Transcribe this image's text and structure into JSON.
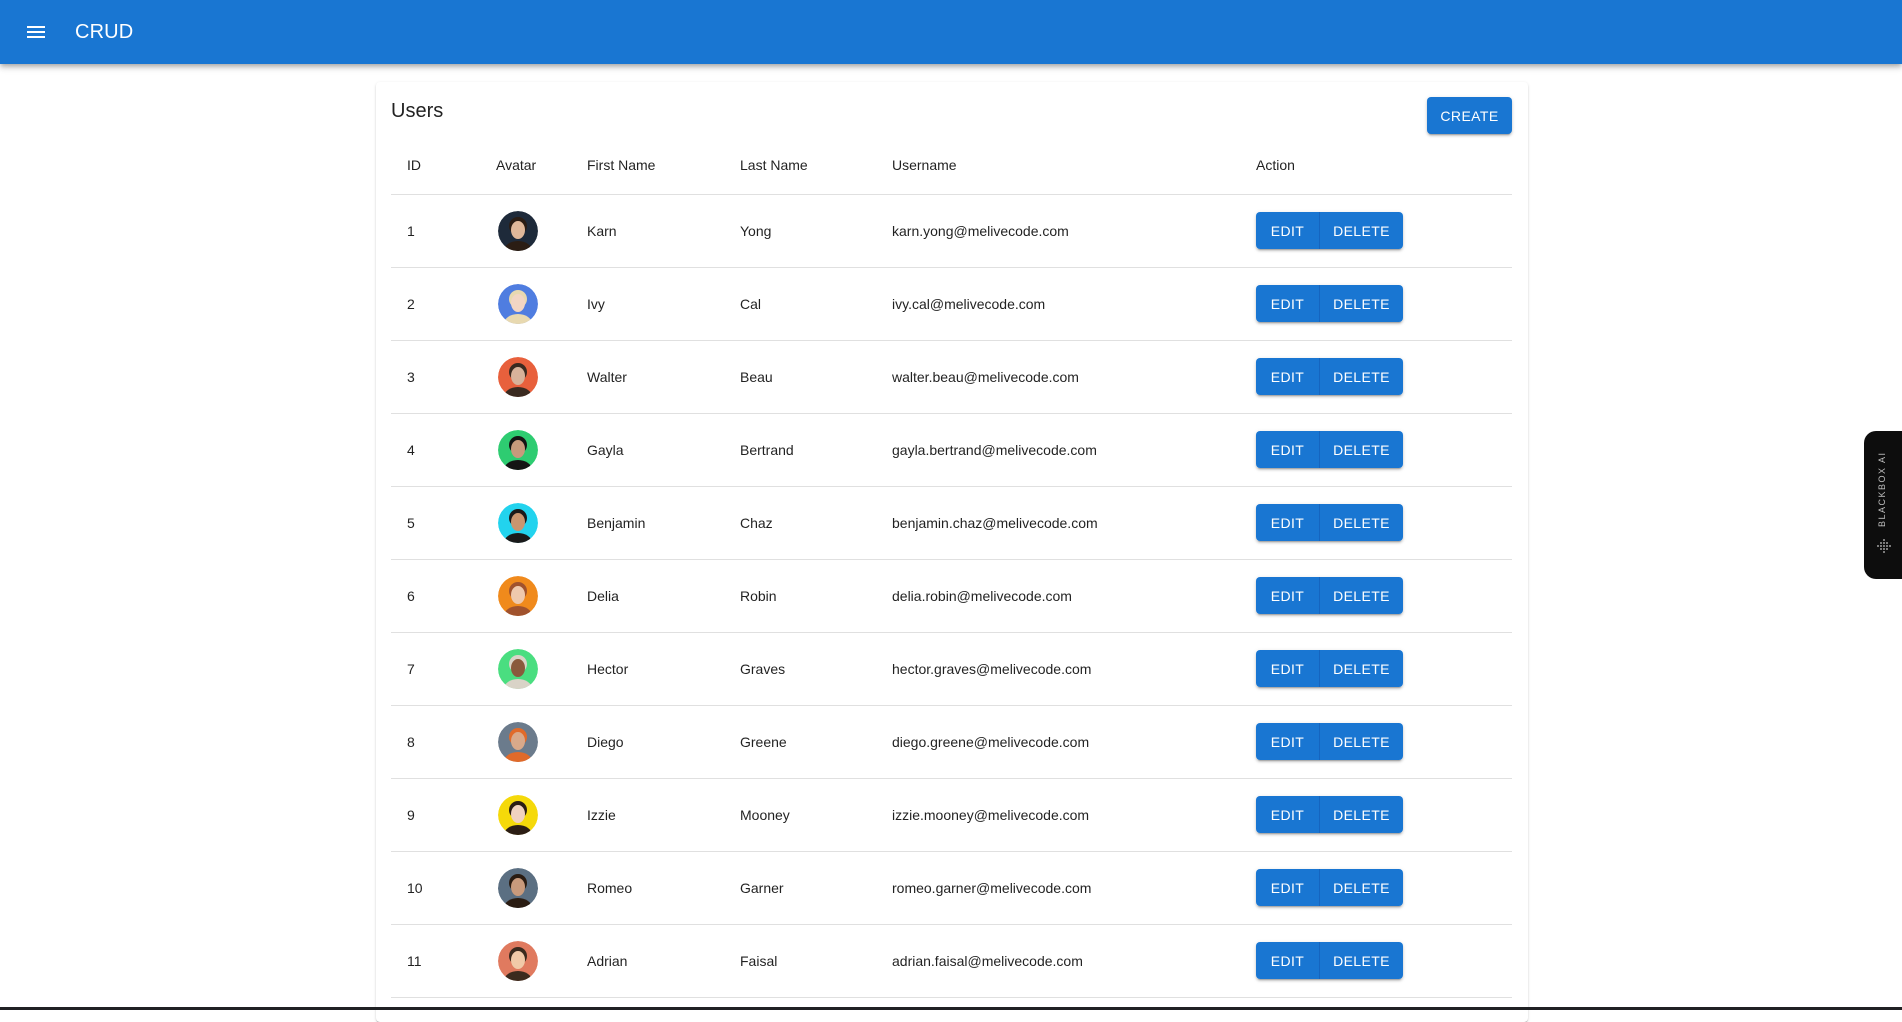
{
  "appbar": {
    "title": "CRUD",
    "menu_icon": "menu-icon",
    "color": "#1976d2"
  },
  "page": {
    "title": "Users",
    "create_label": "CREATE"
  },
  "table": {
    "columns": {
      "id": "ID",
      "avatar": "Avatar",
      "first_name": "First Name",
      "last_name": "Last Name",
      "username": "Username",
      "action": "Action"
    },
    "edit_label": "EDIT",
    "delete_label": "DELETE",
    "rows": [
      {
        "id": "1",
        "first_name": "Karn",
        "last_name": "Yong",
        "username": "karn.yong@melivecode.com",
        "avatar_bg": "#1e2a3a",
        "avatar_skin": "#e0b89a",
        "avatar_hair": "#2b1d14"
      },
      {
        "id": "2",
        "first_name": "Ivy",
        "last_name": "Cal",
        "username": "ivy.cal@melivecode.com",
        "avatar_bg": "#4f7de0",
        "avatar_skin": "#f2d6c4",
        "avatar_hair": "#e8d9b0"
      },
      {
        "id": "3",
        "first_name": "Walter",
        "last_name": "Beau",
        "username": "walter.beau@melivecode.com",
        "avatar_bg": "#e8603c",
        "avatar_skin": "#d8b29a",
        "avatar_hair": "#3a2a20"
      },
      {
        "id": "4",
        "first_name": "Gayla",
        "last_name": "Bertrand",
        "username": "gayla.bertrand@melivecode.com",
        "avatar_bg": "#2ecc71",
        "avatar_skin": "#c89a7c",
        "avatar_hair": "#141414"
      },
      {
        "id": "5",
        "first_name": "Benjamin",
        "last_name": "Chaz",
        "username": "benjamin.chaz@melivecode.com",
        "avatar_bg": "#22d3ee",
        "avatar_skin": "#c9956f",
        "avatar_hair": "#1a1a1a"
      },
      {
        "id": "6",
        "first_name": "Delia",
        "last_name": "Robin",
        "username": "delia.robin@melivecode.com",
        "avatar_bg": "#f08a1c",
        "avatar_skin": "#efc9ad",
        "avatar_hair": "#a0522d"
      },
      {
        "id": "7",
        "first_name": "Hector",
        "last_name": "Graves",
        "username": "hector.graves@melivecode.com",
        "avatar_bg": "#4ade80",
        "avatar_skin": "#8a5a3c",
        "avatar_hair": "#d9d3c7"
      },
      {
        "id": "8",
        "first_name": "Diego",
        "last_name": "Greene",
        "username": "diego.greene@melivecode.com",
        "avatar_bg": "#6b7b8c",
        "avatar_skin": "#d9a98a",
        "avatar_hair": "#e06a2a"
      },
      {
        "id": "9",
        "first_name": "Izzie",
        "last_name": "Mooney",
        "username": "izzie.mooney@melivecode.com",
        "avatar_bg": "#f5d90a",
        "avatar_skin": "#f1d2bf",
        "avatar_hair": "#2b1d14"
      },
      {
        "id": "10",
        "first_name": "Romeo",
        "last_name": "Garner",
        "username": "romeo.garner@melivecode.com",
        "avatar_bg": "#5b6f82",
        "avatar_skin": "#c89a7c",
        "avatar_hair": "#2a1c12"
      },
      {
        "id": "11",
        "first_name": "Adrian",
        "last_name": "Faisal",
        "username": "adrian.faisal@melivecode.com",
        "avatar_bg": "#e07a5f",
        "avatar_skin": "#f1c9a8",
        "avatar_hair": "#3b2a1e"
      }
    ]
  },
  "side_widget": {
    "label": "BLACKBOX AI",
    "logo_icon": "blackbox-logo-icon"
  }
}
